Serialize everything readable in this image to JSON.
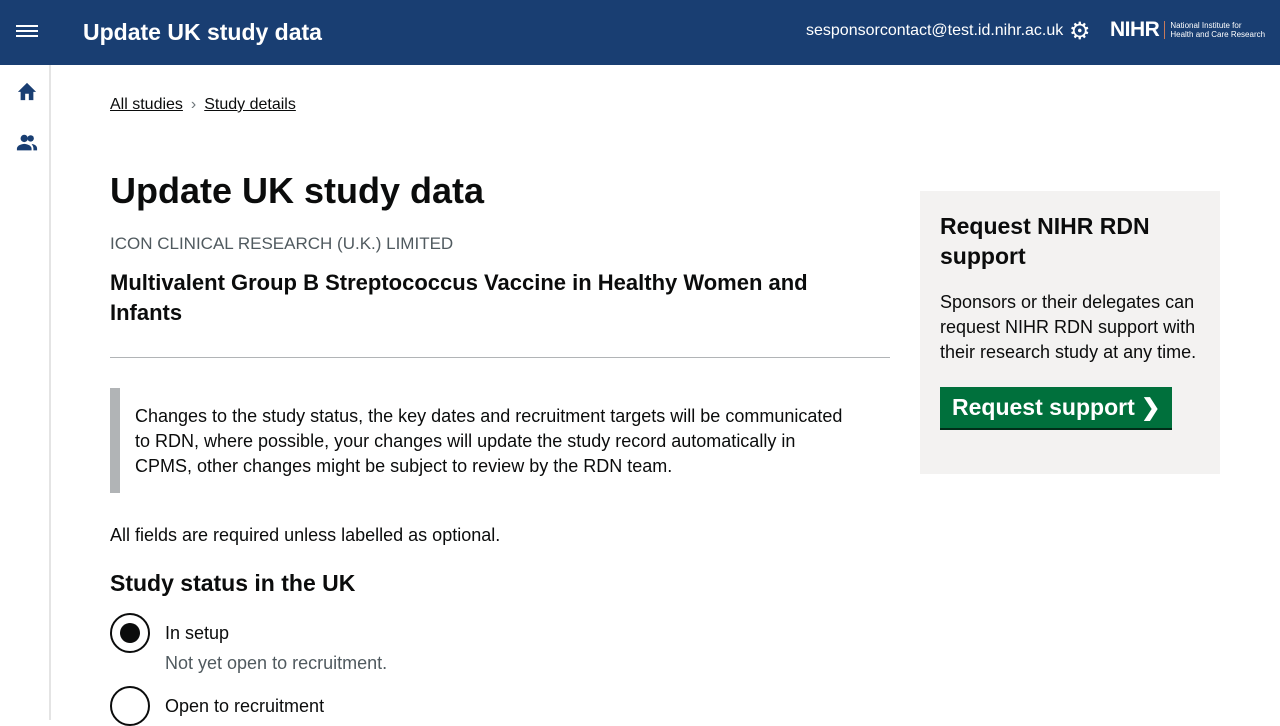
{
  "header": {
    "title": "Update UK study data",
    "email": "sesponsorcontact@test.id.nihr.ac.uk",
    "logo_text": "NIHR",
    "logo_sub1": "National Institute for",
    "logo_sub2": "Health and Care Research"
  },
  "breadcrumb": {
    "items": [
      "All studies",
      "Study details"
    ],
    "separator": "›"
  },
  "page": {
    "title": "Update UK study data",
    "organisation": "ICON CLINICAL RESEARCH (U.K.) LIMITED",
    "study_title": "Multivalent Group B Streptococcus Vaccine in Healthy Women and Infants",
    "inset": "Changes to the study status, the key dates and recruitment targets will be communicated to RDN, where possible, your changes will update the study record automatically in CPMS, other changes might be subject to review by the RDN team.",
    "required_note": "All fields are required unless labelled as optional.",
    "section_heading": "Study status in the UK",
    "options": [
      {
        "label": "In setup",
        "hint": "Not yet open to recruitment.",
        "selected": true
      },
      {
        "label": "Open to recruitment",
        "selected": false
      }
    ]
  },
  "panel": {
    "heading": "Request NIHR RDN support",
    "body": "Sponsors or their delegates can request NIHR RDN support with their research study at any time.",
    "button": "Request support ❯"
  }
}
